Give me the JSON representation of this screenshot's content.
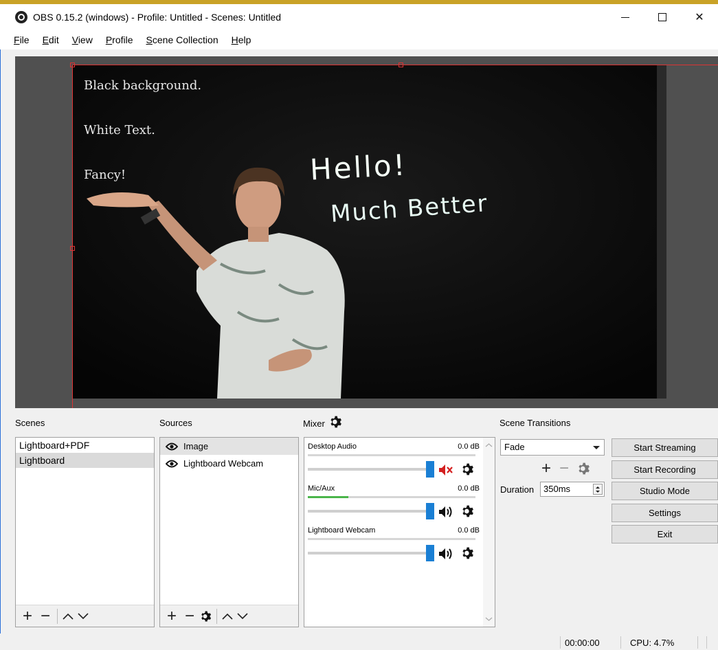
{
  "window": {
    "title": "OBS 0.15.2 (windows) - Profile: Untitled - Scenes: Untitled",
    "minimize": "minimize",
    "maximize": "maximize",
    "close": "✕"
  },
  "menu": [
    {
      "u": "F",
      "rest": "ile"
    },
    {
      "u": "E",
      "rest": "dit"
    },
    {
      "u": "V",
      "rest": "iew"
    },
    {
      "u": "P",
      "rest": "rofile"
    },
    {
      "u": "S",
      "rest": "cene Collection"
    },
    {
      "u": "H",
      "rest": "elp"
    }
  ],
  "preview": {
    "text1": "Black background.",
    "text2": "White Text.",
    "text3": "Fancy!",
    "hand1": "Hello!",
    "hand2": "Much Better"
  },
  "scenes": {
    "label": "Scenes",
    "items": [
      "Lightboard+PDF",
      "Lightboard"
    ],
    "selected_index": 1
  },
  "sources": {
    "label": "Sources",
    "items": [
      "Image",
      "Lightboard Webcam"
    ],
    "selected_index": 0
  },
  "mixer": {
    "label": "Mixer",
    "channels": [
      {
        "name": "Desktop Audio",
        "db": "0.0 dB",
        "muted": true,
        "level": 0.0
      },
      {
        "name": "Mic/Aux",
        "db": "0.0 dB",
        "muted": false,
        "level": 0.24
      },
      {
        "name": "Lightboard Webcam",
        "db": "0.0 dB",
        "muted": false,
        "level": 0.0
      }
    ]
  },
  "transitions": {
    "label": "Scene Transitions",
    "selected": "Fade",
    "duration_label": "Duration",
    "duration_value": "350ms"
  },
  "controls": {
    "start_streaming": "Start Streaming",
    "start_recording": "Start Recording",
    "studio_mode": "Studio Mode",
    "settings": "Settings",
    "exit": "Exit"
  },
  "status": {
    "time": "00:00:00",
    "cpu": "CPU: 4.7%"
  },
  "colors": {
    "accent_bar": "#c9a227",
    "selection_border": "#dd3333",
    "slider_handle": "#1a7fd4",
    "meter_green": "#4ab54a",
    "mute_red": "#d42020"
  }
}
